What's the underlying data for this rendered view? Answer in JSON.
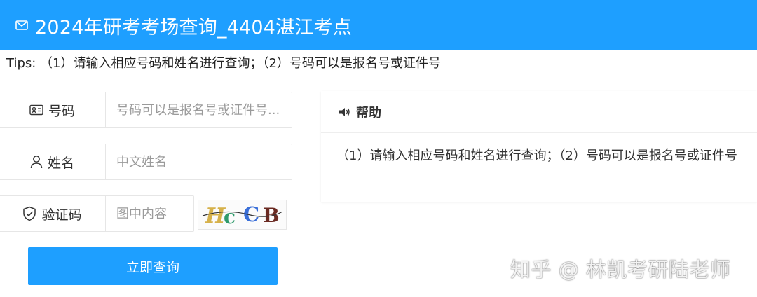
{
  "header": {
    "title": "2024年研考考场查询_4404湛江考点",
    "icon": "mail-icon"
  },
  "tips": {
    "text": "Tips: （1）请输入相应号码和姓名进行查询；（2）号码可以是报名号或证件号"
  },
  "form": {
    "number": {
      "label": "号码",
      "placeholder": "号码可以是报名号或证件号...",
      "icon": "id-card-icon"
    },
    "name": {
      "label": "姓名",
      "placeholder": "中文姓名",
      "icon": "user-icon"
    },
    "captcha": {
      "label": "验证码",
      "placeholder": "图中内容",
      "icon": "shield-icon",
      "image_text": "HCCB"
    },
    "submit_label": "立即查询"
  },
  "help": {
    "title": "帮助",
    "icon": "speaker-icon",
    "body": "（1）请输入相应号码和姓名进行查询；（2）号码可以是报名号或证件号"
  },
  "watermark": {
    "text": "知乎 @ 林凯考研陆老师"
  },
  "colors": {
    "primary": "#1e9fff"
  }
}
